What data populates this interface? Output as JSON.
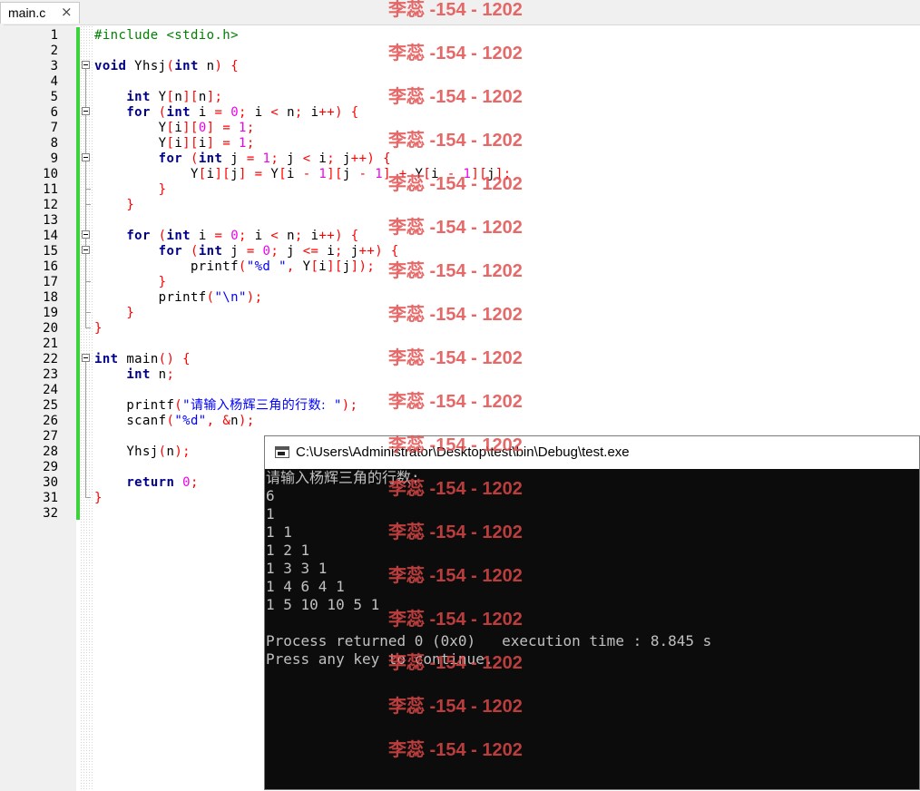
{
  "tab": {
    "label": "main.c",
    "close_icon": "×"
  },
  "editor": {
    "line_numbers": [
      "1",
      "2",
      "3",
      "4",
      "5",
      "6",
      "7",
      "8",
      "9",
      "10",
      "11",
      "12",
      "13",
      "14",
      "15",
      "16",
      "17",
      "18",
      "19",
      "20",
      "21",
      "22",
      "23",
      "24",
      "25",
      "26",
      "27",
      "28",
      "29",
      "30",
      "31",
      "32"
    ]
  },
  "console": {
    "title": "C:\\Users\\Administrator\\Desktop\\test\\bin\\Debug\\test.exe",
    "lines": [
      "请输入杨辉三角的行数:",
      "6",
      "1",
      "1 1",
      "1 2 1",
      "1 3 3 1",
      "1 4 6 4 1",
      "1 5 10 10 5 1",
      "",
      "Process returned 0 (0x0)   execution time : 8.845 s",
      "Press any key to continue."
    ]
  },
  "watermark": {
    "text": "李蕊 -154 - 1202"
  },
  "colors": {
    "keyword": "#00008b",
    "preprocessor": "#008000",
    "number": "#f000f0",
    "operator": "#ff0000",
    "string": "#0000ff",
    "change_bar": "#3cd23c",
    "watermark": "#e24848"
  }
}
